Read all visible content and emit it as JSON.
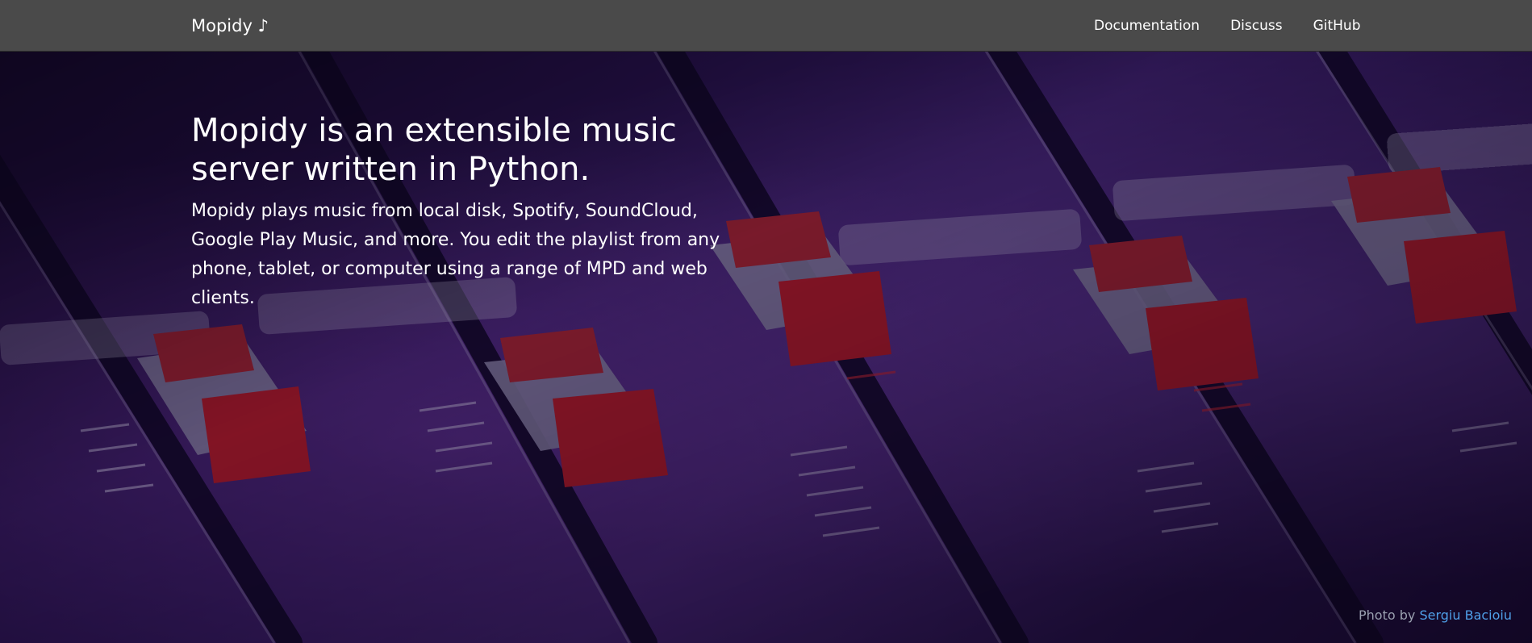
{
  "navbar": {
    "brand": "Mopidy ♪",
    "links": [
      "Documentation",
      "Discuss",
      "GitHub"
    ]
  },
  "hero": {
    "title": "Mopidy is an extensible music server written in Python.",
    "subtitle": "Mopidy plays music from local disk, Spotify, SoundCloud, Google Play Music, and more. You edit the playlist from any phone, tablet, or computer using a range of MPD and web clients."
  },
  "credit": {
    "prefix": "Photo by",
    "author": "Sergiu Bacioiu"
  },
  "colors": {
    "navbar_bg": "#4a4a4a",
    "credit_link": "#4f9fe8",
    "fader_cap_red": "#c01b22",
    "fader_body": "#8f8aa8",
    "hero_tint": "#2a1450"
  }
}
